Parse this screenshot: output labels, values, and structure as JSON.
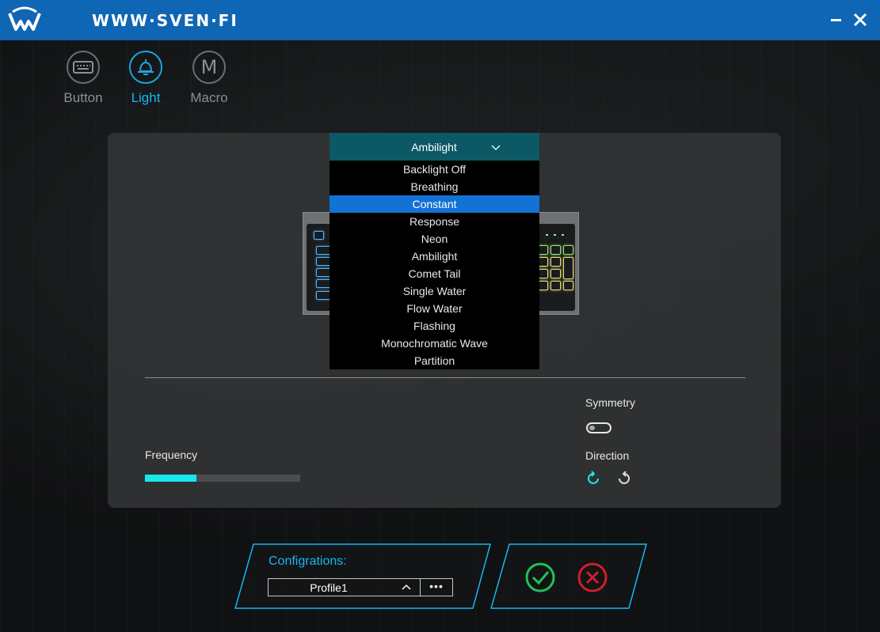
{
  "app": {
    "brand": "WWW·SVEN·FI"
  },
  "window": {
    "minimize_icon": "minimize-icon",
    "close_icon": "close-icon"
  },
  "tabs": [
    {
      "label": "Button",
      "icon": "keyboard-icon",
      "active": false
    },
    {
      "label": "Light",
      "icon": "bell-icon",
      "active": true
    },
    {
      "label": "Macro",
      "icon": "macro-m-icon",
      "glyph": "M",
      "active": false
    }
  ],
  "light_mode": {
    "selected": "Ambilight",
    "options": [
      "Backlight Off",
      "Breathing",
      "Constant",
      "Response",
      "Neon",
      "Ambilight",
      "Comet Tail",
      "Single Water",
      "Flow Water",
      "Flashing",
      "Monochromatic Wave",
      "Partition"
    ],
    "highlighted": "Constant"
  },
  "settings": {
    "frequency_label": "Frequency",
    "frequency_level": 0.33,
    "symmetry_label": "Symmetry",
    "symmetry_on": false,
    "direction_label": "Direction"
  },
  "config": {
    "title": "Configrations:",
    "profile": "Profile1",
    "more_label": "•••"
  },
  "colors": {
    "titlebar": "#0f66b4",
    "accent": "#19b6f0",
    "frequency_fill": "#19e6ec",
    "ok": "#1fc25a",
    "cancel": "#d0202a"
  }
}
